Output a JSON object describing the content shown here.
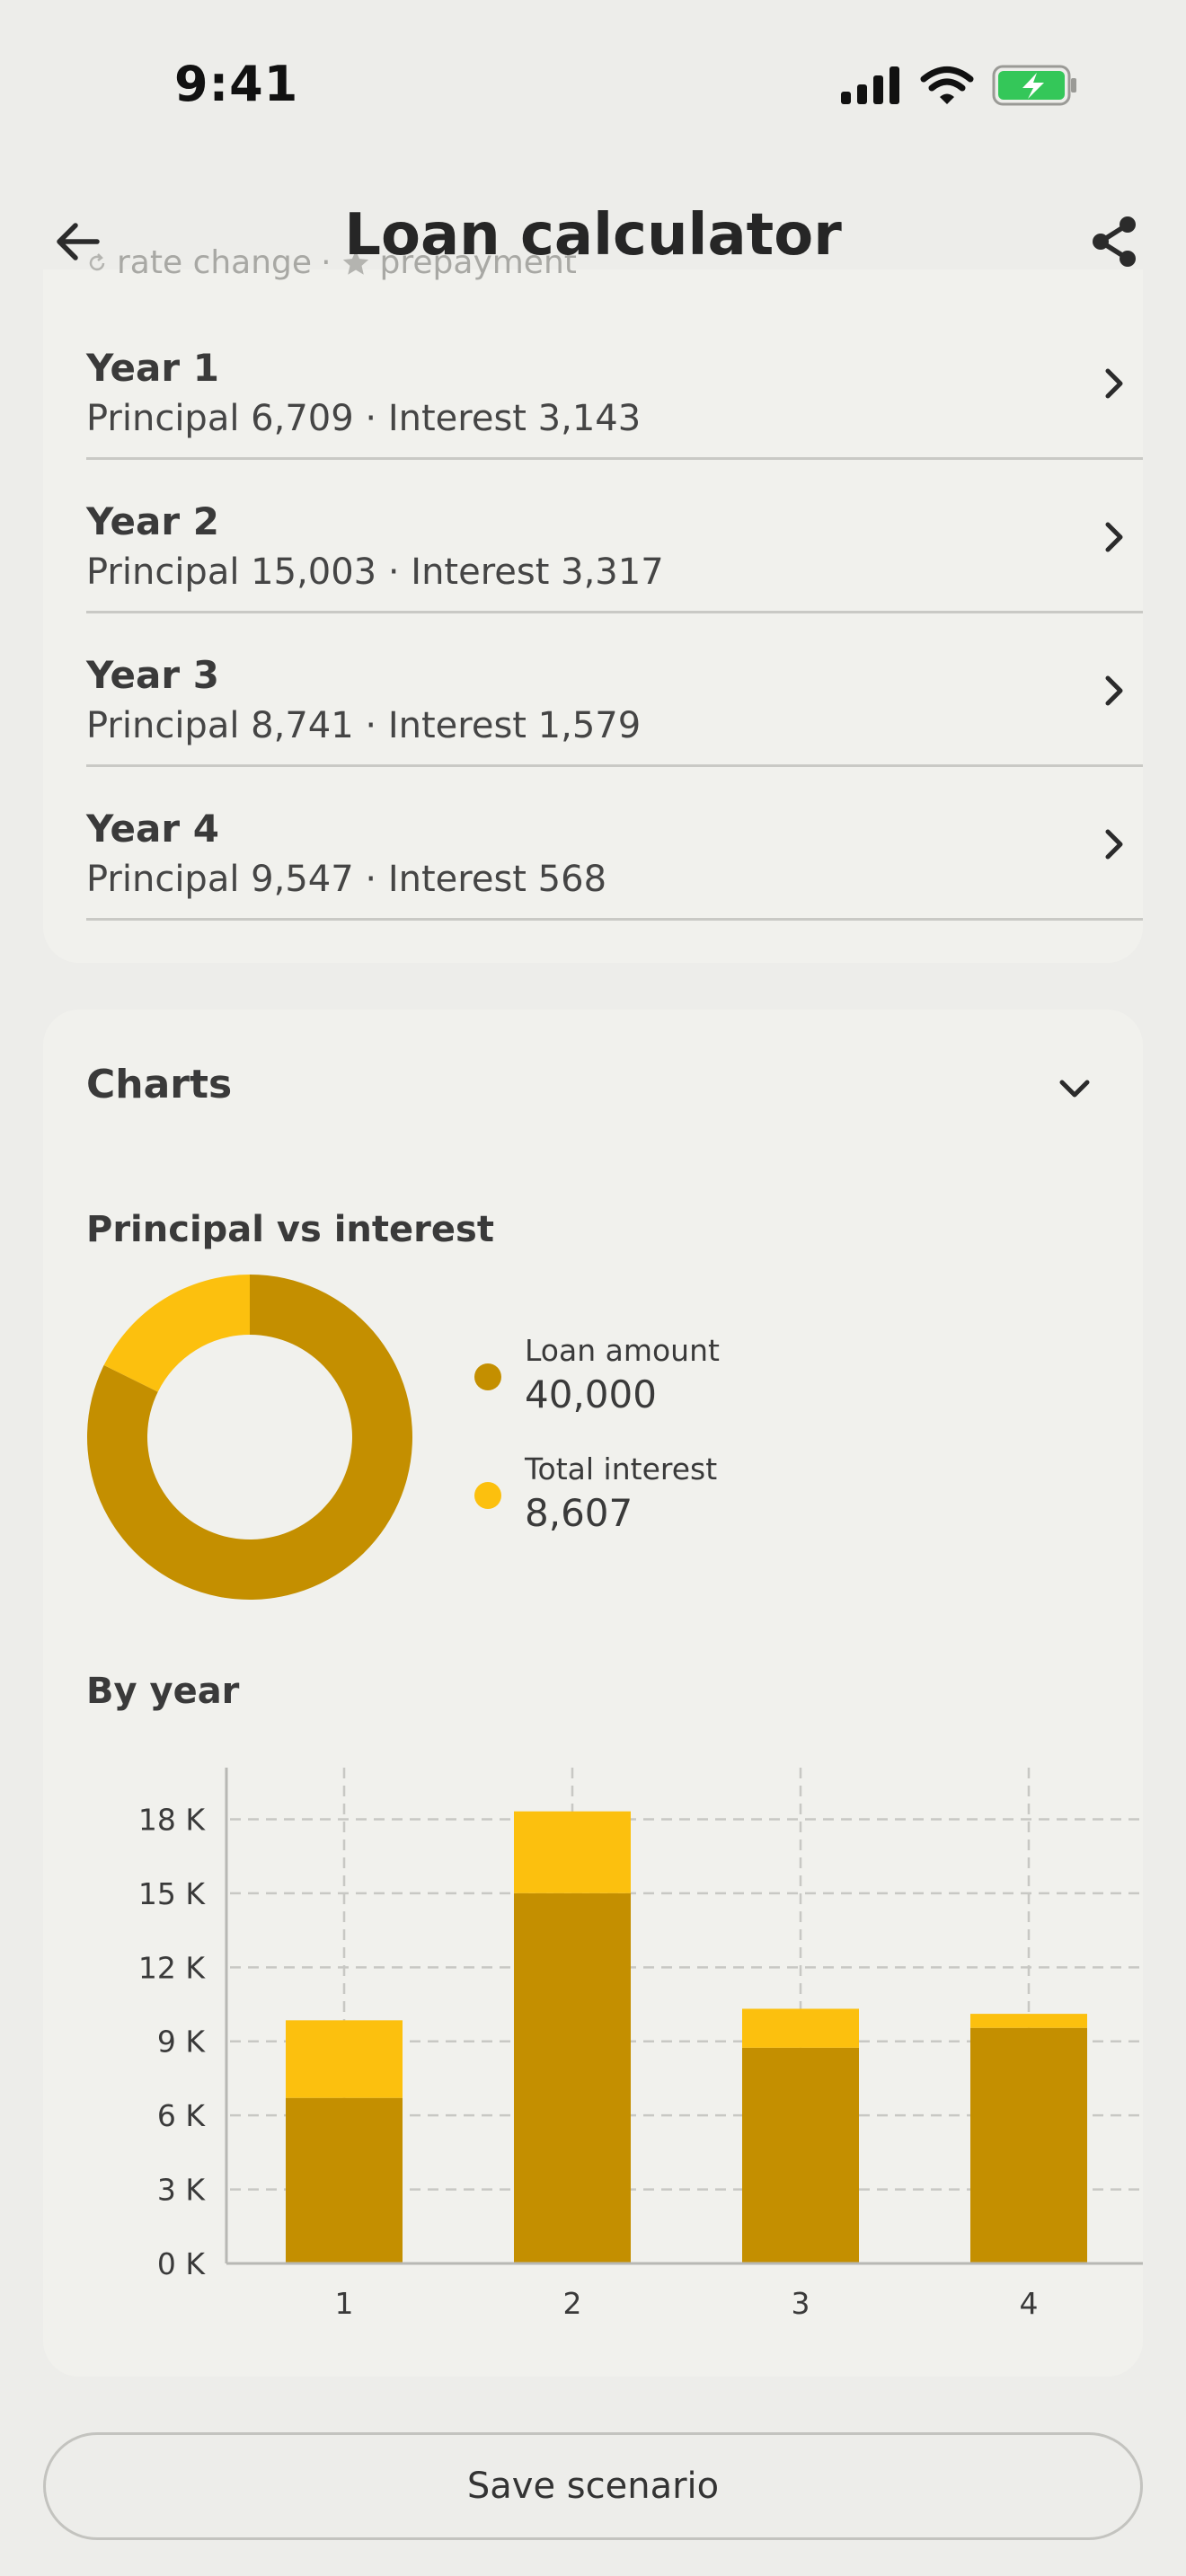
{
  "status_bar": {
    "time": "9:41"
  },
  "header": {
    "title": "Loan calculator",
    "back_icon": "arrow-left-icon",
    "share_icon": "share-icon"
  },
  "legend_hint": {
    "rate_change": "rate change",
    "separator": "·",
    "prepayment": "prepayment"
  },
  "schedule": {
    "rows": [
      {
        "title": "Year 1",
        "detail": "Principal 6,709 · Interest 3,143"
      },
      {
        "title": "Year 2",
        "detail": "Principal 15,003 · Interest 3,317"
      },
      {
        "title": "Year 3",
        "detail": "Principal 8,741 · Interest 1,579"
      },
      {
        "title": "Year 4",
        "detail": "Principal 9,547 · Interest 568"
      }
    ]
  },
  "charts": {
    "title": "Charts",
    "toggle_icon": "chevron-down-icon",
    "donut_heading": "Principal vs interest",
    "bar_heading": "By year"
  },
  "colors": {
    "principal": "#c48f00",
    "interest": "#fcc00e",
    "grid": "#c8c8c4",
    "card": "#f1f1ed"
  },
  "chart_data": [
    {
      "type": "pie",
      "title": "Principal vs interest",
      "series": [
        {
          "name": "Loan amount",
          "value": 40000,
          "label": "40,000"
        },
        {
          "name": "Total interest",
          "value": 8607,
          "label": "8,607"
        }
      ]
    },
    {
      "type": "bar",
      "stacked": true,
      "title": "By year",
      "categories": [
        "1",
        "2",
        "3",
        "4"
      ],
      "series": [
        {
          "values": [
            6709,
            15003,
            8741,
            9547
          ]
        },
        {
          "values": [
            3143,
            3317,
            1579,
            568
          ]
        }
      ],
      "ylim": [
        0,
        19000
      ],
      "yticks": [
        0,
        3000,
        6000,
        9000,
        12000,
        15000,
        18000
      ],
      "ytick_labels": [
        "0 K",
        "3 K",
        "6 K",
        "9 K",
        "12 K",
        "15 K",
        "18 K"
      ],
      "grid": true
    }
  ],
  "actions": {
    "save_label": "Save scenario"
  }
}
